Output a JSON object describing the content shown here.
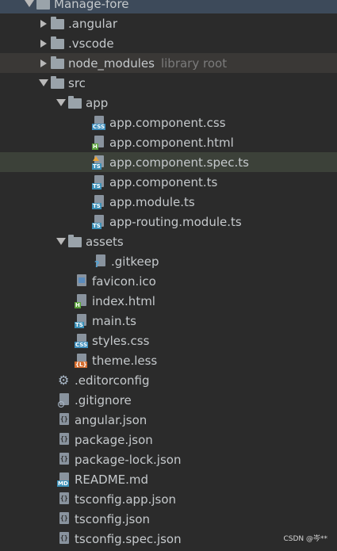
{
  "project": {
    "root": "Manage-fore"
  },
  "tree": {
    "angular": ".angular",
    "vscode": ".vscode",
    "node_modules": "node_modules",
    "library_root": "library root",
    "src": "src",
    "app": "app",
    "app_component_css": "app.component.css",
    "app_component_html": "app.component.html",
    "app_component_spec_ts": "app.component.spec.ts",
    "app_component_ts": "app.component.ts",
    "app_module_ts": "app.module.ts",
    "app_routing_module_ts": "app-routing.module.ts",
    "assets": "assets",
    "gitkeep": ".gitkeep",
    "favicon": "favicon.ico",
    "index_html": "index.html",
    "main_ts": "main.ts",
    "styles_css": "styles.css",
    "theme_less": "theme.less",
    "editorconfig": ".editorconfig",
    "gitignore": ".gitignore",
    "angular_json": "angular.json",
    "package_json": "package.json",
    "package_lock_json": "package-lock.json",
    "readme": "README.md",
    "tsconfig_app_json": "tsconfig.app.json",
    "tsconfig_json": "tsconfig.json",
    "tsconfig_spec_json": "tsconfig.spec.json"
  },
  "badges": {
    "css": "CSS",
    "html": "H",
    "ts": "TS",
    "md": "MD",
    "less": "{L}",
    "json": "{}",
    "q": "?"
  },
  "watermark": "CSDN @岑**",
  "colors": {
    "background": "#2b2b2b",
    "text": "#c5c9cc",
    "selected_row": "#3c4139",
    "library_row": "#3a3836",
    "library_text": "#7b7b7b",
    "top_row": "#3d4a5a"
  }
}
